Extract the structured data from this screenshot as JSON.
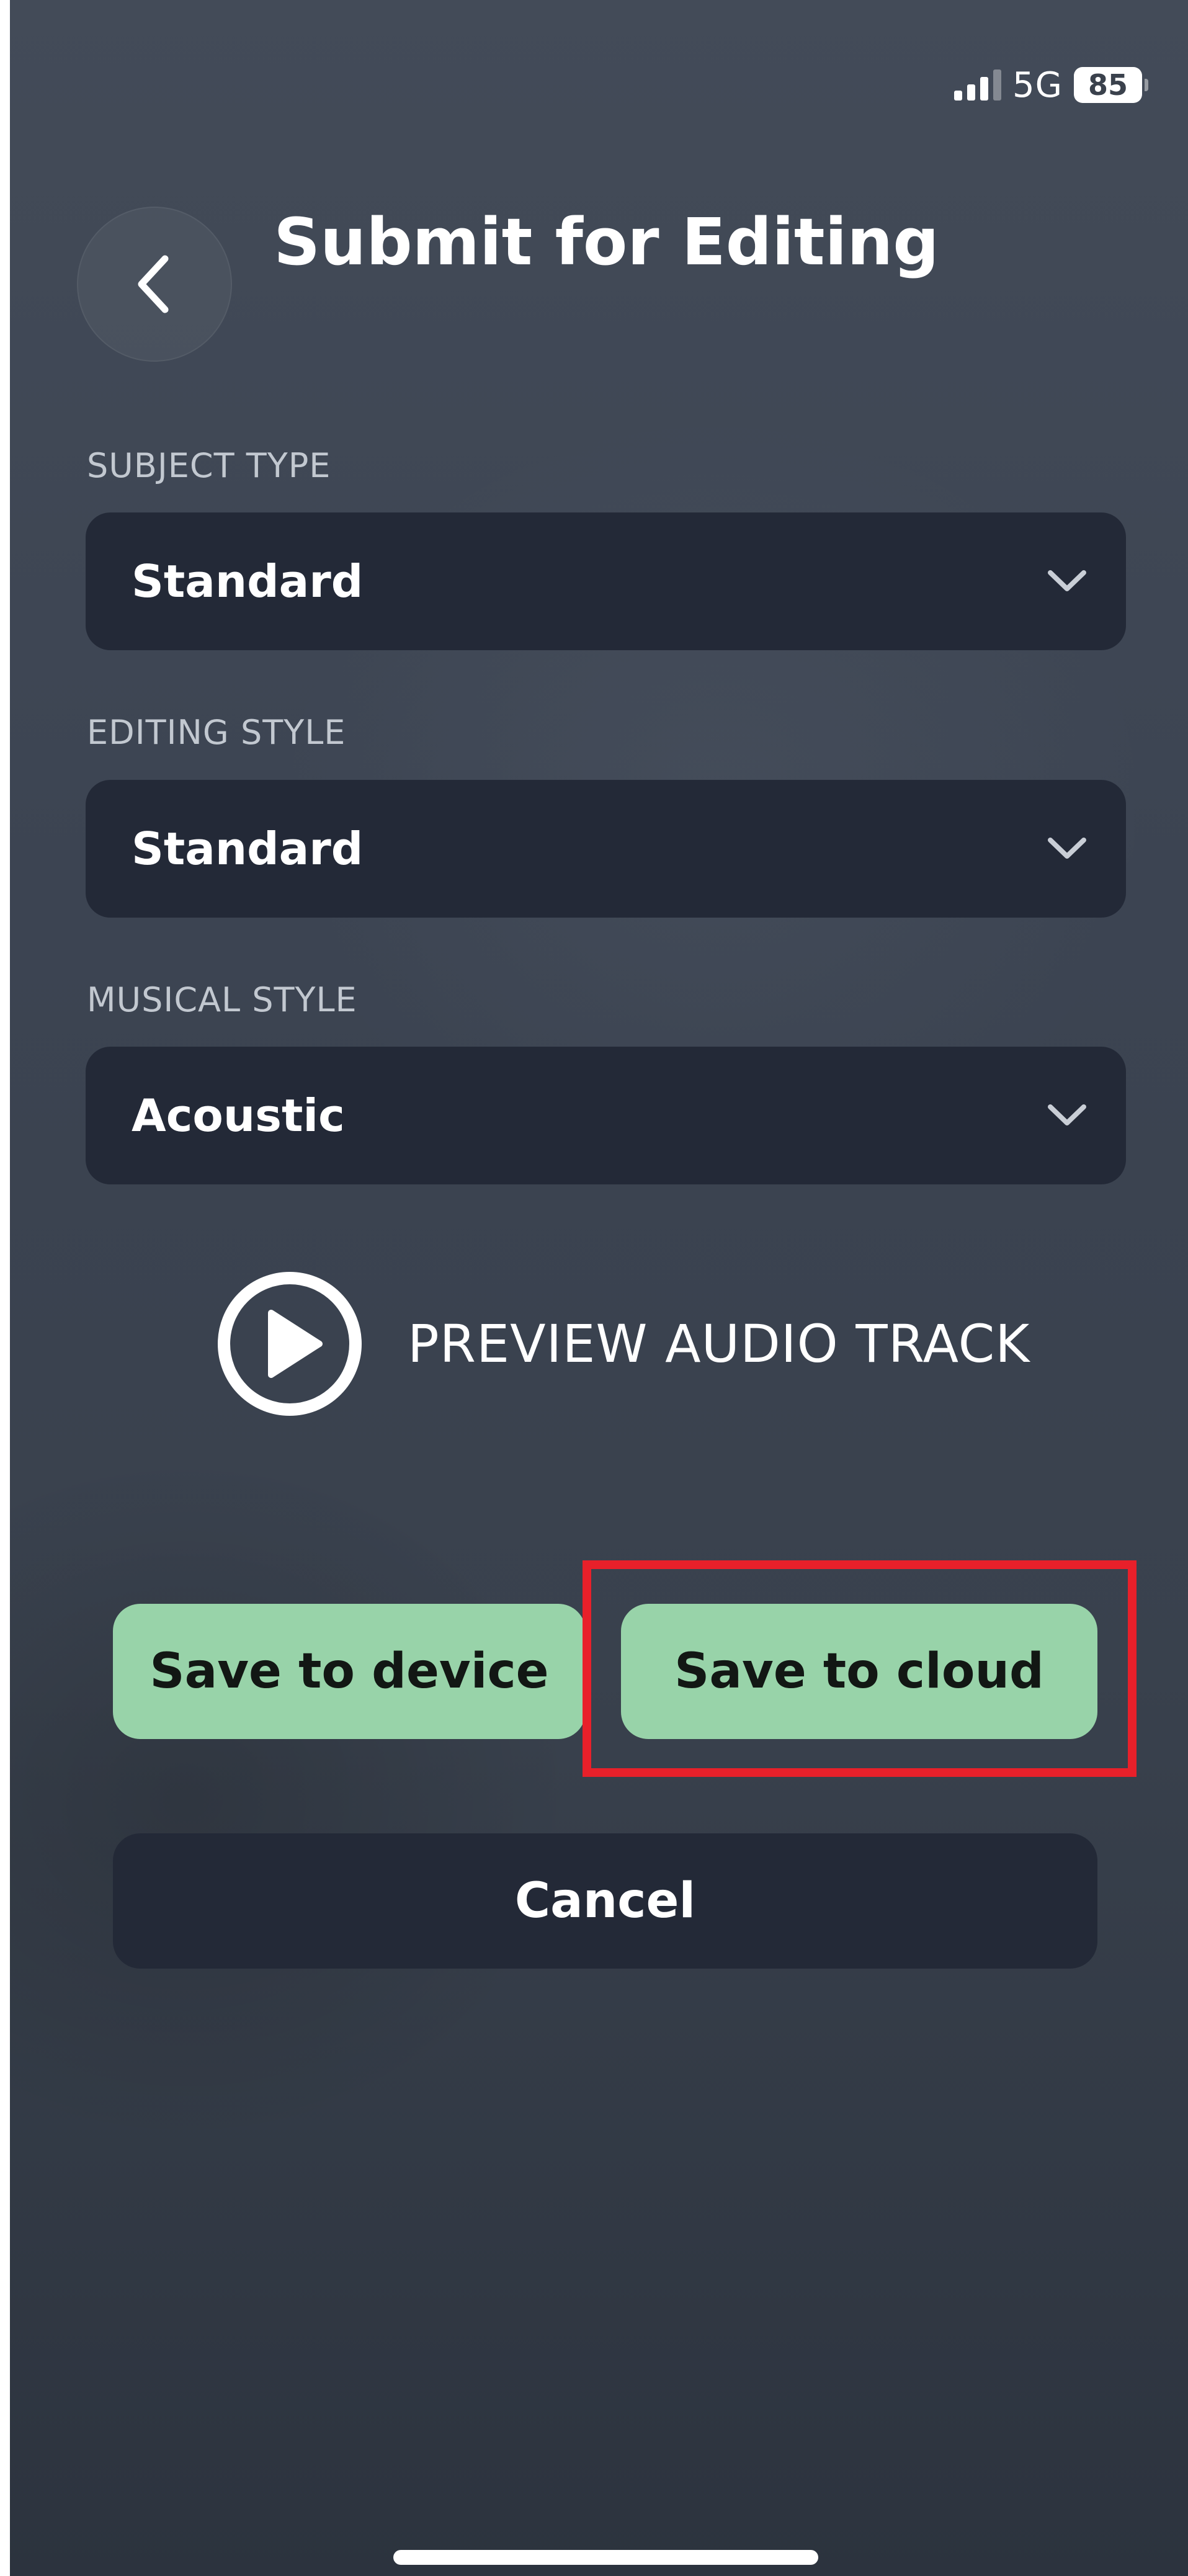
{
  "status_bar": {
    "network": "5G",
    "battery": "85",
    "signal_icon": "signal-bars-icon",
    "battery_icon": "battery-icon"
  },
  "header": {
    "title": "Submit for Editing",
    "back_icon": "chevron-left-icon"
  },
  "form": {
    "subject_type": {
      "label": "SUBJECT TYPE",
      "value": "Standard"
    },
    "editing_style": {
      "label": "EDITING STYLE",
      "value": "Standard"
    },
    "musical_style": {
      "label": "MUSICAL STYLE",
      "value": "Acoustic"
    },
    "dropdown_icon": "chevron-down-icon"
  },
  "preview": {
    "label": "PREVIEW AUDIO TRACK",
    "icon": "play-circle-icon"
  },
  "actions": {
    "save_device": "Save to device",
    "save_cloud": "Save to cloud",
    "cancel": "Cancel"
  },
  "colors": {
    "accent_green": "#98d3a9",
    "field_bg": "#232937",
    "highlight_red": "#e8202a"
  }
}
